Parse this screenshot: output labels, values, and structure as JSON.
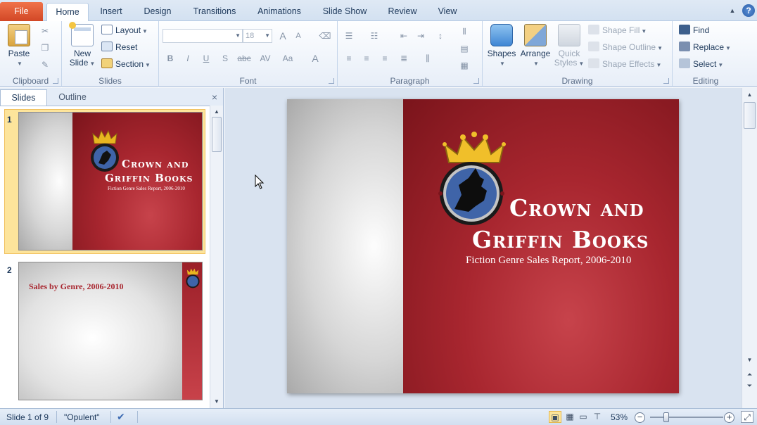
{
  "tabs": [
    {
      "label": "File"
    },
    {
      "label": "Home"
    },
    {
      "label": "Insert"
    },
    {
      "label": "Design"
    },
    {
      "label": "Transitions"
    },
    {
      "label": "Animations"
    },
    {
      "label": "Slide Show"
    },
    {
      "label": "Review"
    },
    {
      "label": "View"
    }
  ],
  "window": {
    "help_label": "?",
    "minimize_ribbon_glyph": "▲"
  },
  "ribbon": {
    "clipboard": {
      "label": "Clipboard",
      "paste": "Paste"
    },
    "slides": {
      "label": "Slides",
      "new_slide": "New",
      "new_slide_2": "Slide",
      "layout": "Layout",
      "reset": "Reset",
      "section": "Section"
    },
    "font": {
      "label": "Font",
      "font_name": "",
      "font_size": "18",
      "bold": "B",
      "italic": "I",
      "underline": "U",
      "shadow": "S",
      "strike": "abc",
      "spacing": "AV",
      "case": "Aa",
      "color": "A",
      "grow": "A",
      "shrink": "A"
    },
    "paragraph": {
      "label": "Paragraph"
    },
    "drawing": {
      "label": "Drawing",
      "shapes": "Shapes",
      "arrange": "Arrange",
      "quick_styles": "Quick",
      "quick_styles_2": "Styles",
      "shape_fill": "Shape Fill",
      "shape_outline": "Shape Outline",
      "shape_effects": "Shape Effects"
    },
    "editing": {
      "label": "Editing",
      "find": "Find",
      "replace": "Replace",
      "select": "Select"
    }
  },
  "panel": {
    "tabs": [
      {
        "label": "Slides"
      },
      {
        "label": "Outline"
      }
    ],
    "close_glyph": "×",
    "slides": [
      {
        "number": "1",
        "title_1": "Crown and",
        "title_2": "Griffin Books",
        "subtitle": "Fiction Genre Sales Report, 2006-2010"
      },
      {
        "number": "2",
        "title": "Sales by Genre, 2006-2010"
      }
    ]
  },
  "current_slide": {
    "title_1": "Crown and",
    "title_2": "Griffin Books",
    "subtitle": "Fiction Genre Sales Report, 2006-2010"
  },
  "statusbar": {
    "slide_info": "Slide 1 of 9",
    "theme": "\"Opulent\"",
    "zoom": "53%",
    "zoom_minus": "−",
    "zoom_plus": "+"
  },
  "colors": {
    "accent_red": "#a8262f",
    "file_tab": "#d24726",
    "ribbon_text": "#1e395b"
  }
}
